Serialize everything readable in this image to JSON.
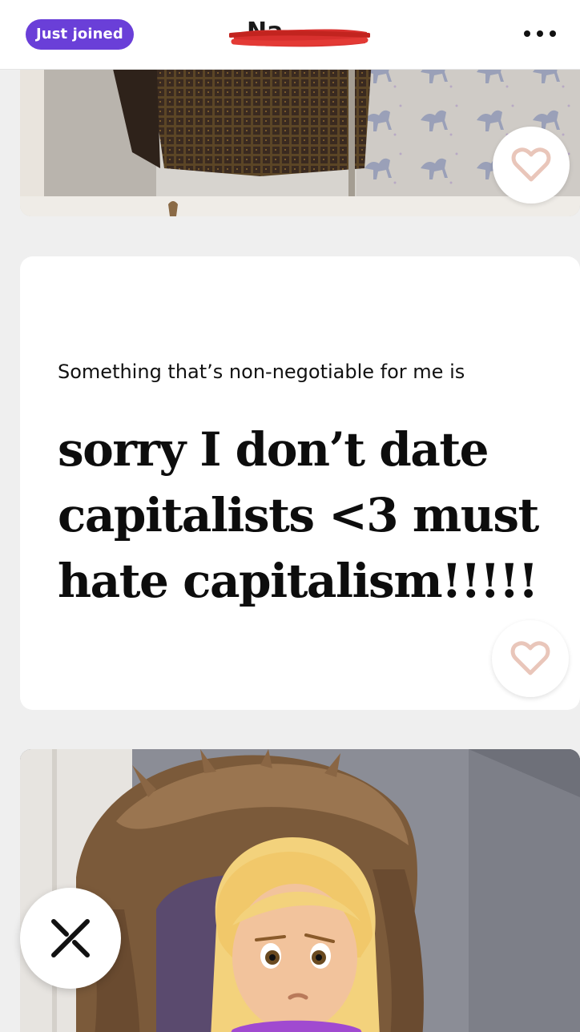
{
  "header": {
    "badge_label": "Just joined",
    "name_fragment": "Na",
    "more_icon": "more-horizontal-icon"
  },
  "photo_1": {
    "description_icon": "profile-photo",
    "like_icon": "heart-icon"
  },
  "prompt": {
    "question": "Something that’s non-negotiable for me is",
    "answer": "sorry I don’t date capitalists <3 must hate capitalism!!!!!",
    "like_icon": "heart-icon"
  },
  "photo_2": {
    "description_icon": "profile-photo",
    "overlay_emoji": "🙎‍♀️"
  },
  "dismiss": {
    "icon": "close-x-icon"
  },
  "colors": {
    "accent": "#6a3fd8",
    "heart": "#e9c6ba",
    "redaction": "#d8302e",
    "background": "#efefef",
    "card": "#ffffff"
  }
}
